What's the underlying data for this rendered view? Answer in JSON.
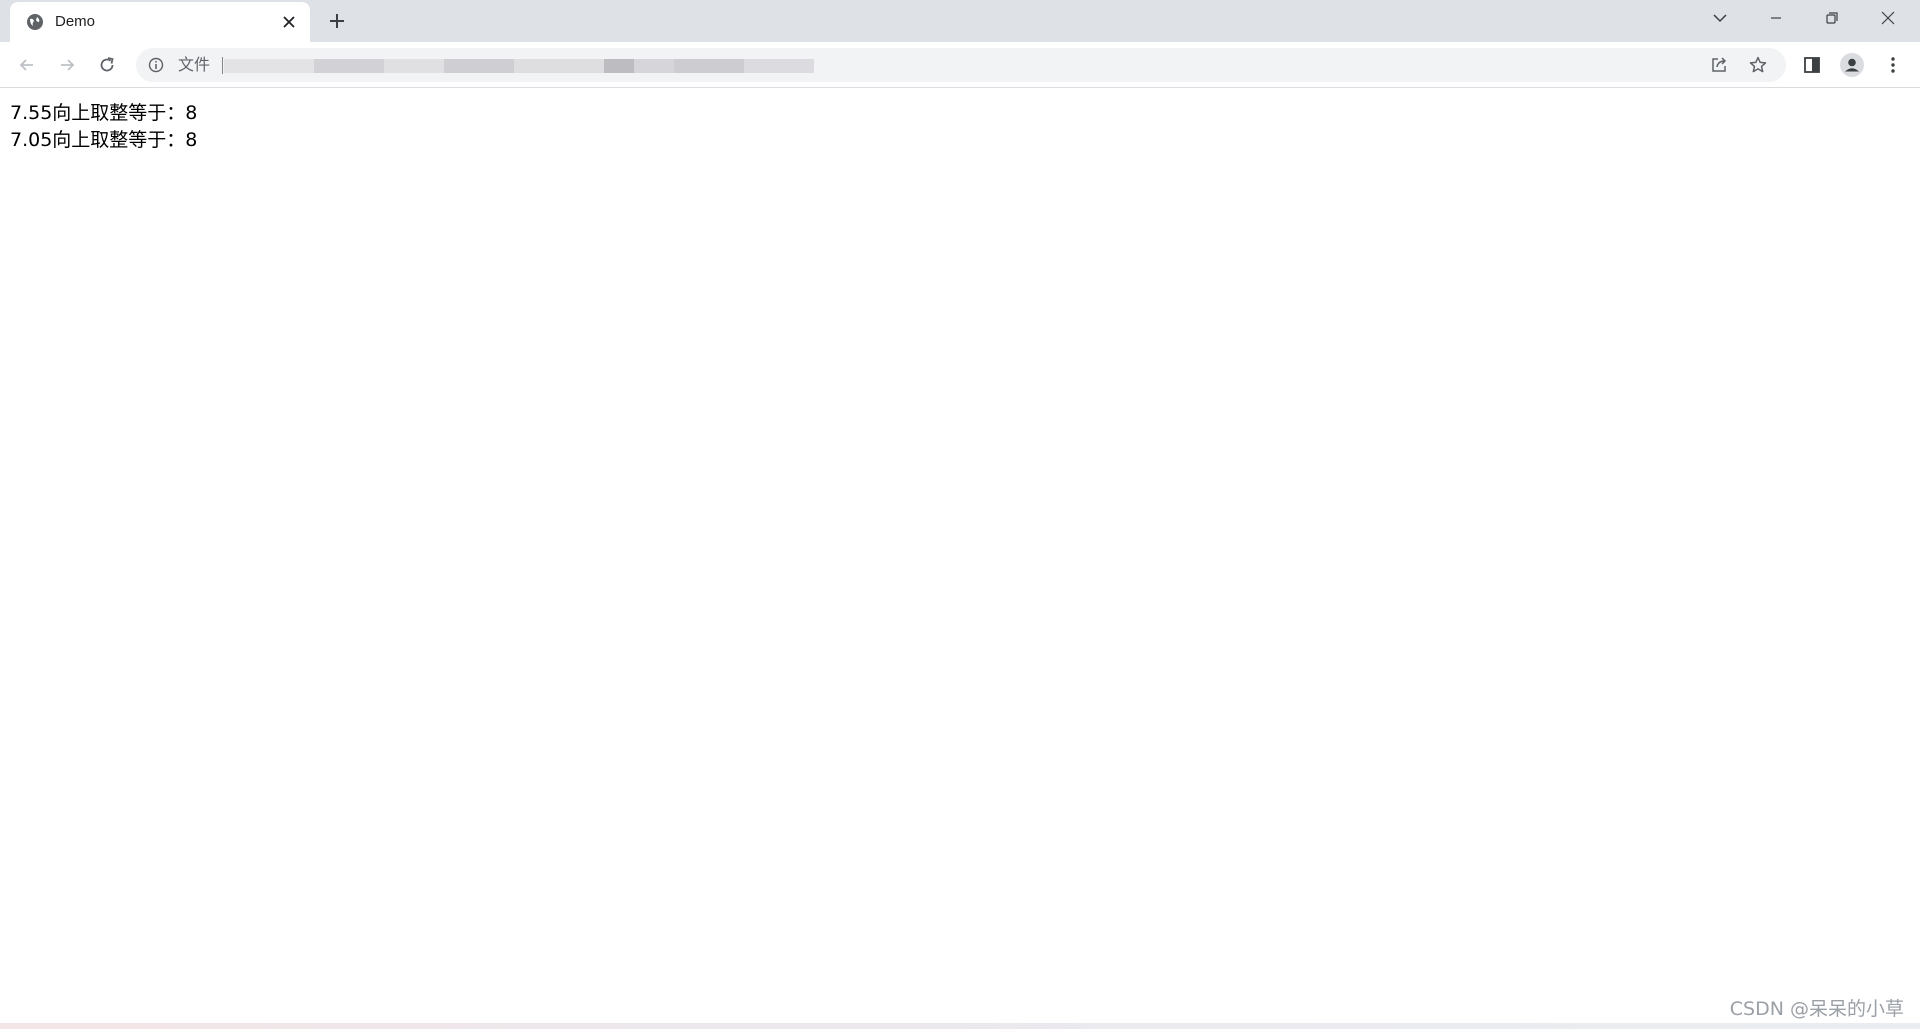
{
  "browser": {
    "tab": {
      "title": "Demo",
      "favicon": "globe-icon"
    },
    "address_bar": {
      "scheme_label": "文件",
      "url": ""
    },
    "icons": {
      "back": "arrow-left-icon",
      "forward": "arrow-right-icon",
      "reload": "reload-icon",
      "share": "share-icon",
      "bookmark": "star-icon",
      "side_panel": "side-panel-icon",
      "profile": "profile-icon",
      "menu": "kebab-menu-icon"
    }
  },
  "page": {
    "lines": [
      "7.55向上取整等于：8",
      "7.05向上取整等于：8"
    ]
  },
  "watermark": "CSDN @呆呆的小草",
  "colors": {
    "tabstrip": "#dee1e6",
    "omnibox": "#f1f3f4",
    "icon": "#5f6368",
    "text": "#000000"
  }
}
